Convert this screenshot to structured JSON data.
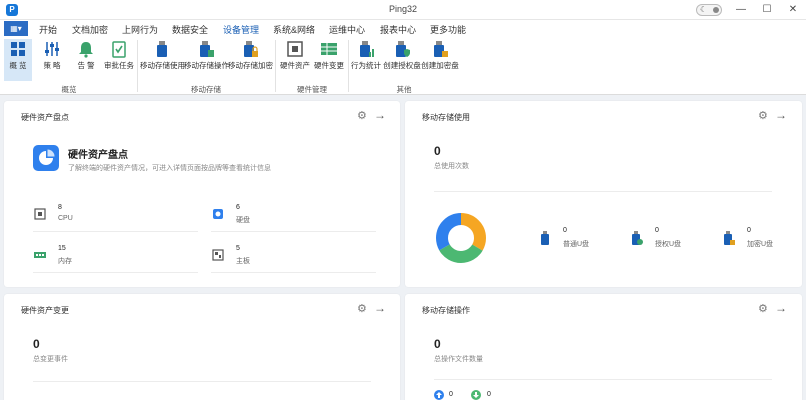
{
  "window": {
    "title": "Ping32",
    "minimize": "—",
    "maximize": "☐",
    "close": "✕"
  },
  "menu": {
    "home_icon": "▦▾",
    "tabs": [
      "开始",
      "文档加密",
      "上网行为",
      "数据安全",
      "设备管理",
      "系统&网络",
      "运维中心",
      "报表中心",
      "更多功能"
    ],
    "active_index": 4
  },
  "ribbon": {
    "buttons": [
      {
        "label": "概 览",
        "icon": "overview-icon"
      },
      {
        "label": "策 略",
        "icon": "sliders-icon"
      },
      {
        "label": "告 警",
        "icon": "bell-icon"
      },
      {
        "label": "审批任务",
        "icon": "clipboard-check-icon"
      },
      {
        "label": "移动存储使用",
        "icon": "usb-icon"
      },
      {
        "label": "移动存储操作",
        "icon": "usb-doc-icon"
      },
      {
        "label": "移动存储加密",
        "icon": "usb-lock-icon"
      },
      {
        "label": "硬件资产",
        "icon": "cpu-icon"
      },
      {
        "label": "硬件变更",
        "icon": "table-icon"
      },
      {
        "label": "行为统计",
        "icon": "usb-chart-icon"
      },
      {
        "label": "创建授权盘",
        "icon": "usb-shield-icon"
      },
      {
        "label": "创建加密盘",
        "icon": "usb-key-icon"
      }
    ],
    "groups": [
      "概览",
      "移动存储",
      "硬件管理",
      "其他"
    ]
  },
  "cards": {
    "hw_inventory": {
      "title": "硬件资产盘点",
      "heading": "硬件资产盘点",
      "desc": "了解终端的硬件资产情况，可进入详情页面按品牌等查看统计信息",
      "stats": [
        {
          "value": "8",
          "label": "CPU",
          "icon": "cpu-icon"
        },
        {
          "value": "6",
          "label": "硬盘",
          "icon": "disk-icon"
        },
        {
          "value": "15",
          "label": "内存",
          "icon": "memory-icon"
        },
        {
          "value": "5",
          "label": "主板",
          "icon": "motherboard-icon"
        }
      ]
    },
    "usb_usage": {
      "title": "移动存储使用",
      "total": "0",
      "total_label": "总使用次数",
      "items": [
        {
          "value": "0",
          "label": "普通U盘",
          "icon": "usb-icon"
        },
        {
          "value": "0",
          "label": "授权U盘",
          "icon": "usb-check-icon"
        },
        {
          "value": "0",
          "label": "加密U盘",
          "icon": "usb-lock-icon"
        }
      ],
      "donut_colors": [
        "#f5a623",
        "#4cb872",
        "#2f80ed"
      ]
    },
    "hw_change": {
      "title": "硬件资产变更",
      "total": "0",
      "total_label": "总变更事件"
    },
    "usb_ops": {
      "title": "移动存储操作",
      "total": "0",
      "total_label": "总操作文件数量",
      "up": "0",
      "down": "0"
    }
  },
  "colors": {
    "accent": "#1a5fb4",
    "background": "#eef1f5"
  }
}
